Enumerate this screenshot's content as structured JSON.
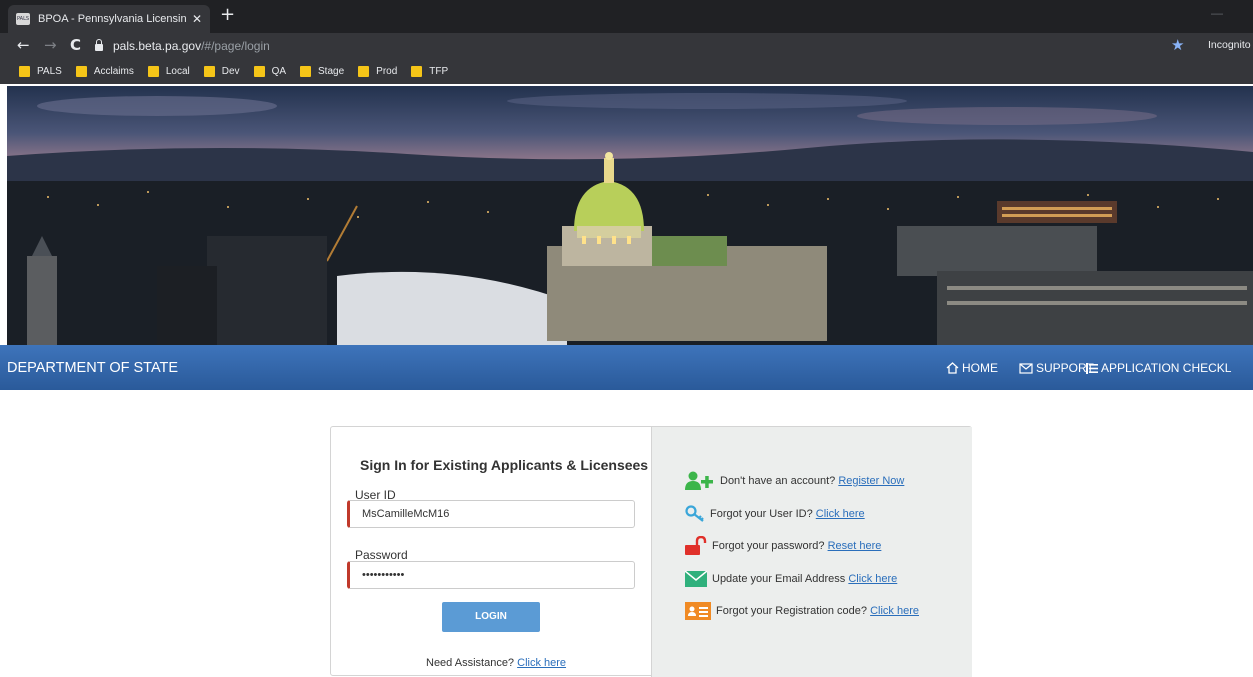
{
  "browser": {
    "tab_title": "BPOA - Pennsylvania Licensing Sy",
    "tab_favicon_text": "PALS",
    "url_host": "pals.beta.pa.gov",
    "url_path": "/#/page/login",
    "profile_label": "Incognito",
    "bookmarks": [
      "PALS",
      "Acclaims",
      "Local",
      "Dev",
      "QA",
      "Stage",
      "Prod",
      "TFP"
    ]
  },
  "header": {
    "dept_title": "DEPARTMENT OF STATE",
    "nav": [
      {
        "label": "HOME",
        "icon": "home-icon"
      },
      {
        "label": "SUPPORT",
        "icon": "envelope-icon"
      },
      {
        "label": "APPLICATION CHECKL",
        "icon": "list-icon"
      }
    ]
  },
  "login": {
    "title": "Sign In for Existing Applicants & Licensees",
    "user_id_label": "User ID",
    "user_id_value": "MsCamilleMcM16",
    "password_label": "Password",
    "password_value": "•••••••••••",
    "login_button": "LOGIN",
    "assist_text": "Need Assistance?",
    "assist_link": "Click here"
  },
  "help": [
    {
      "text": "Don't have an account?",
      "link": "Register Now",
      "icon": "add-user-icon",
      "color": "#3cb54a"
    },
    {
      "text": "Forgot your User ID?",
      "link": "Click here",
      "icon": "key-icon",
      "color": "#3aa6d9"
    },
    {
      "text": "Forgot your password?",
      "link": "Reset here",
      "icon": "unlock-icon",
      "color": "#e0302a"
    },
    {
      "text": "Update your Email Address",
      "link": "Click here",
      "icon": "envelope-icon",
      "color": "#2fb07c"
    },
    {
      "text": "Forgot your Registration code?",
      "link": "Click here",
      "icon": "id-card-icon",
      "color": "#f08a24"
    }
  ],
  "colors": {
    "navbar": "#2f63a8",
    "button": "#5b9bd5",
    "link": "#2a6ebb",
    "required_bar": "#c0392b"
  }
}
